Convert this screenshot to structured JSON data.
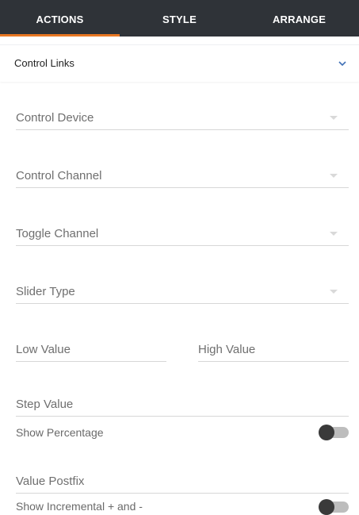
{
  "tabs": [
    {
      "label": "ACTIONS",
      "active": true
    },
    {
      "label": "STYLE",
      "active": false
    },
    {
      "label": "ARRANGE",
      "active": false
    }
  ],
  "section": {
    "title": "Control Links",
    "icon": "chevron-down-icon"
  },
  "fields": {
    "control_device": "Control Device",
    "control_channel": "Control Channel",
    "toggle_channel": "Toggle Channel",
    "slider_type": "Slider Type",
    "low_value": "Low Value",
    "high_value": "High Value",
    "step_value": "Step Value",
    "value_postfix": "Value Postfix"
  },
  "toggles": {
    "show_percentage": {
      "label": "Show Percentage",
      "on": false
    },
    "show_incremental": {
      "label": "Show Incremental + and -",
      "on": false
    }
  },
  "colors": {
    "tab_bar": "#2f3338",
    "accent": "#e87722",
    "chevron": "#3f6fb5"
  }
}
